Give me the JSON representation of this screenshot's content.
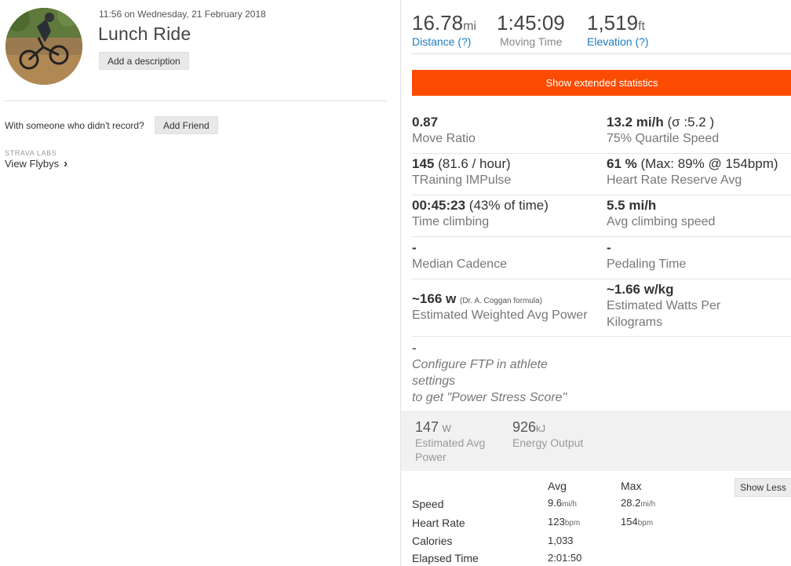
{
  "activity": {
    "timestamp": "11:56 on Wednesday, 21 February 2018",
    "title": "Lunch Ride",
    "add_description_label": "Add a description",
    "someone_text": "With someone who didn't record?",
    "add_friend_label": "Add Friend",
    "labs_label": "STRAVA LABS",
    "flybys_label": "View Flybys",
    "flybys_icon": "chevron-right-icon"
  },
  "top_stats": [
    {
      "value": "16.78",
      "unit": "mi",
      "label": "Distance (?)",
      "label_color": "#1c7cc1"
    },
    {
      "value": "1:45:09",
      "unit": "",
      "label": "Moving Time",
      "label_color": "#888888"
    },
    {
      "value": "1,519",
      "unit": "ft",
      "label": "Elevation (?)",
      "label_color": "#1c7cc1"
    }
  ],
  "extended_button_label": "Show extended statistics",
  "accent_color": "#fc4c02",
  "extended_stats": [
    {
      "left": {
        "value": "0.87",
        "extra": "",
        "label": "Move Ratio"
      },
      "right": {
        "value": "13.2 mi/h",
        "extra": " (σ :5.2 )",
        "label": "75% Quartile Speed"
      }
    },
    {
      "left": {
        "value": "145",
        "extra": " (81.6 / hour)",
        "label": "TRaining IMPulse"
      },
      "right": {
        "value": "61 %",
        "extra": " (Max: 89% @ 154bpm)",
        "label": "Heart Rate Reserve Avg"
      }
    },
    {
      "left": {
        "value": "00:45:23",
        "extra": " (43% of time)",
        "label": "Time climbing"
      },
      "right": {
        "value": "5.5 mi/h",
        "extra": "",
        "label": "Avg climbing speed"
      }
    },
    {
      "left": {
        "value": "-",
        "extra": "",
        "label": "Median Cadence"
      },
      "right": {
        "value": "-",
        "extra": "",
        "label": "Pedaling Time"
      }
    },
    {
      "left": {
        "value": "~166 w",
        "extra": "(Dr. A. Coggan formula)",
        "label": "Estimated Weighted Avg Power"
      },
      "right": {
        "value": "~1.66 w/kg",
        "extra": "",
        "label": "Estimated Watts Per Kilograms"
      }
    }
  ],
  "power_stress": {
    "value": "-",
    "lines": [
      "Configure FTP in athlete",
      "settings",
      "to get \"Power Stress Score\""
    ]
  },
  "power_box": [
    {
      "value": "147",
      "unit": "W",
      "label_lines": [
        "Estimated Avg",
        "Power"
      ]
    },
    {
      "value": "926",
      "unit": "kJ",
      "label_lines": [
        "Energy Output"
      ]
    }
  ],
  "summary_table": {
    "headers": [
      "Avg",
      "Max"
    ],
    "show_less_label": "Show Less",
    "rows": [
      {
        "label": "Speed",
        "avg": "9.6",
        "avg_unit": "mi/h",
        "max": "28.2",
        "max_unit": "mi/h"
      },
      {
        "label": "Heart Rate",
        "avg": "123",
        "avg_unit": "bpm",
        "max": "154",
        "max_unit": "bpm"
      },
      {
        "label": "Calories",
        "avg": "1,033",
        "avg_unit": "",
        "max": "",
        "max_unit": ""
      },
      {
        "label": "Elapsed Time",
        "avg": "2:01:50",
        "avg_unit": "",
        "max": "",
        "max_unit": ""
      }
    ]
  }
}
